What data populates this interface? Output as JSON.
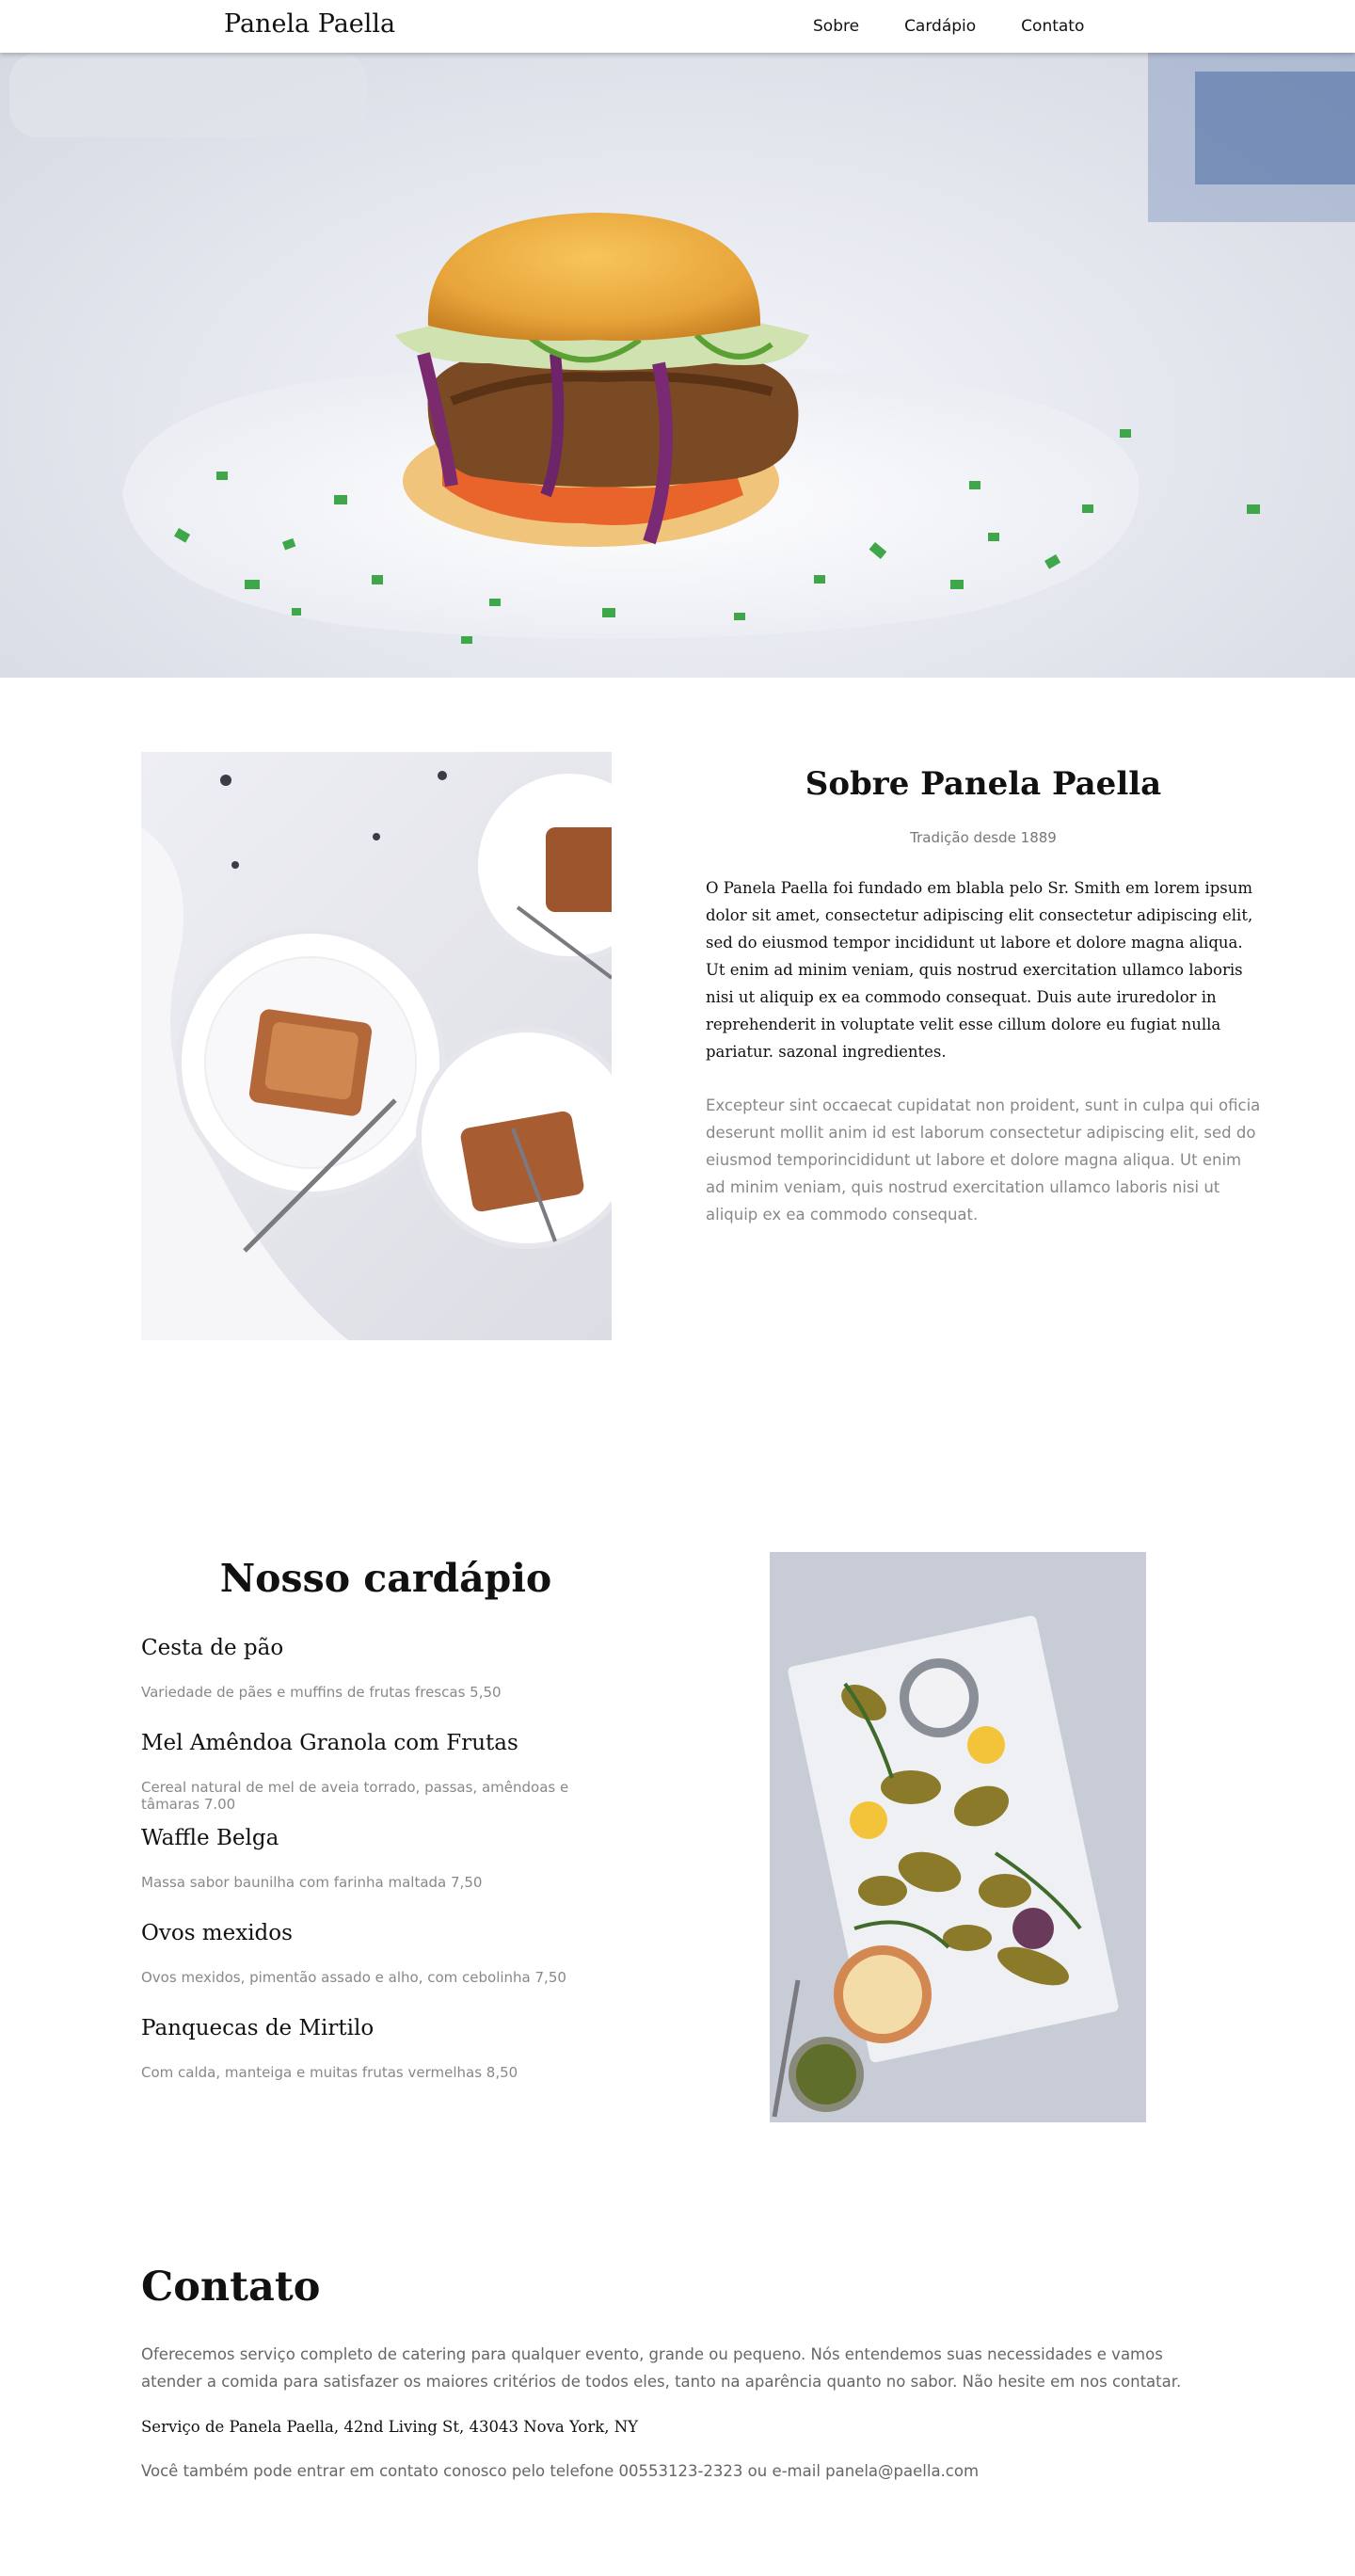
{
  "nav": {
    "brand": "Panela Paella",
    "links": [
      "Sobre",
      "Cardápio",
      "Contato"
    ]
  },
  "about": {
    "title": "Sobre Panela Paella",
    "subtitle": "Tradição desde 1889",
    "paragraph1": "O Panela Paella foi fundado em blabla pelo Sr. Smith em lorem ipsum dolor sit amet, consectetur adipiscing elit consectetur adipiscing elit, sed do eiusmod tempor incididunt ut labore et dolore magna aliqua. Ut enim ad minim veniam, quis nostrud exercitation ullamco laboris nisi ut aliquip ex ea commodo consequat. Duis aute iruredolor in reprehenderit in voluptate velit esse cillum dolore eu fugiat nulla pariatur. sazonal ingredientes.",
    "paragraph2": "Excepteur sint occaecat cupidatat non proident, sunt in culpa qui oficia deserunt mollit anim id est laborum consectetur adipiscing elit, sed do eiusmod temporincididunt ut labore et dolore magna aliqua. Ut enim ad minim veniam, quis nostrud exercitation ullamco laboris nisi ut aliquip ex ea commodo consequat."
  },
  "menu": {
    "title": "Nosso cardápio",
    "items": [
      {
        "name": "Cesta de pão",
        "description": "Variedade de pães e muffins de frutas frescas 5,50"
      },
      {
        "name": "Mel Amêndoa Granola com Frutas",
        "description": "Cereal natural de mel de aveia torrado, passas, amêndoas e tâmaras 7.00"
      },
      {
        "name": "Waffle Belga",
        "description": "Massa sabor baunilha com farinha maltada 7,50"
      },
      {
        "name": "Ovos mexidos",
        "description": "Ovos mexidos, pimentão assado e alho, com cebolinha 7,50"
      },
      {
        "name": "Panquecas de Mirtilo",
        "description": "Com calda, manteiga e muitas frutas vermelhas 8,50"
      }
    ]
  },
  "contact": {
    "title": "Contato",
    "paragraph": "Oferecemos serviço completo de catering para qualquer evento, grande ou pequeno. Nós entendemos suas necessidades e vamos atender a comida para satisfazer os maiores critérios de todos eles, tanto na aparência quanto no sabor. Não hesite em nos contatar.",
    "address": "Serviço de Panela Paella, 42nd Living St, 43043 Nova York, NY",
    "phone_line": "Você também pode entrar em contato conosco pelo telefone 00553123-2323 ou e-mail panela@paella.com"
  }
}
